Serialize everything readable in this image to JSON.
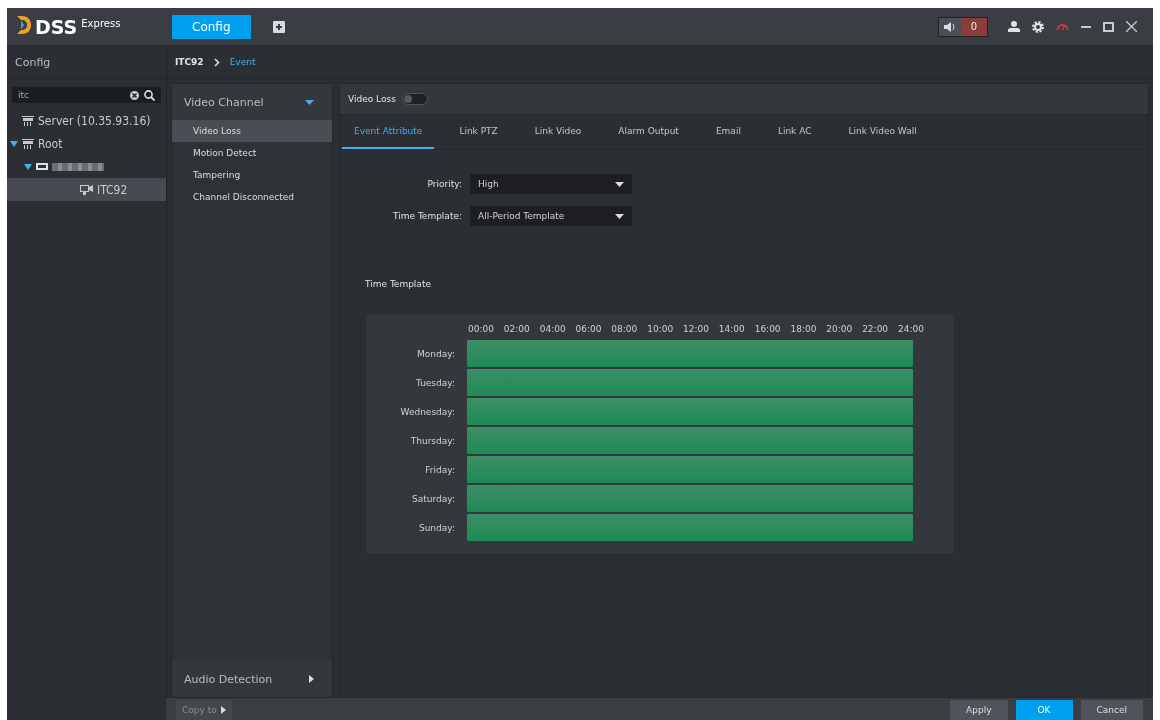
{
  "app": {
    "logo": "DSS",
    "logo_suffix": "Express",
    "tabs": [
      {
        "label": "Config",
        "selected": true
      }
    ],
    "alarm_count": "0"
  },
  "sidebar": {
    "title": "Config",
    "search": {
      "value": "itc"
    },
    "tree": [
      {
        "label": "Server (10.35.93.16)",
        "kind": "server",
        "selected": false
      },
      {
        "label": "Root",
        "kind": "server",
        "expanded": true,
        "selected": false,
        "children": [
          {
            "kind": "blurred",
            "expanded": true,
            "selected": false,
            "children": [
              {
                "label": "ITC92",
                "kind": "camera",
                "selected": true
              }
            ]
          }
        ]
      }
    ]
  },
  "breadcrumb": [
    {
      "label": "ITC92",
      "current": false
    },
    {
      "label": "Event",
      "current": true
    }
  ],
  "event_nav": [
    {
      "label": "Video Channel",
      "expanded": true,
      "items": [
        {
          "label": "Video Loss",
          "selected": true
        },
        {
          "label": "Motion Detect",
          "selected": false
        },
        {
          "label": "Tampering",
          "selected": false
        },
        {
          "label": "Channel Disconnected",
          "selected": false
        }
      ]
    },
    {
      "label": "Audio Detection",
      "expanded": false
    }
  ],
  "event": {
    "title": "Video Loss",
    "on": false,
    "tabs": [
      {
        "label": "Event Attribute",
        "selected": true
      },
      {
        "label": "Link PTZ",
        "selected": false
      },
      {
        "label": "Link Video",
        "selected": false
      },
      {
        "label": "Alarm Output",
        "selected": false
      },
      {
        "label": "Email",
        "selected": false
      },
      {
        "label": "Link AC",
        "selected": false
      },
      {
        "label": "Link Video Wall",
        "selected": false
      }
    ],
    "fields": [
      {
        "label": "Priority:",
        "value": "High"
      },
      {
        "label": "Time Template:",
        "value": "All-Period Template"
      }
    ],
    "schedule": {
      "title": "Time Template",
      "hours": [
        "00:00",
        "02:00",
        "04:00",
        "06:00",
        "08:00",
        "10:00",
        "12:00",
        "14:00",
        "16:00",
        "18:00",
        "20:00",
        "22:00",
        "24:00"
      ],
      "days": [
        {
          "label": "Monday:"
        },
        {
          "label": "Tuesday:"
        },
        {
          "label": "Wednesday:"
        },
        {
          "label": "Thursday:"
        },
        {
          "label": "Friday:"
        },
        {
          "label": "Saturday:"
        },
        {
          "label": "Sunday:"
        }
      ]
    }
  },
  "footer": {
    "buttons": [
      {
        "label": "Copy to",
        "kind": "copy",
        "disabled": true
      },
      {
        "label": "Apply",
        "kind": "normal",
        "disabled": false
      },
      {
        "label": "OK",
        "kind": "primary",
        "disabled": false
      },
      {
        "label": "Cancel",
        "kind": "normal",
        "disabled": false
      }
    ]
  }
}
